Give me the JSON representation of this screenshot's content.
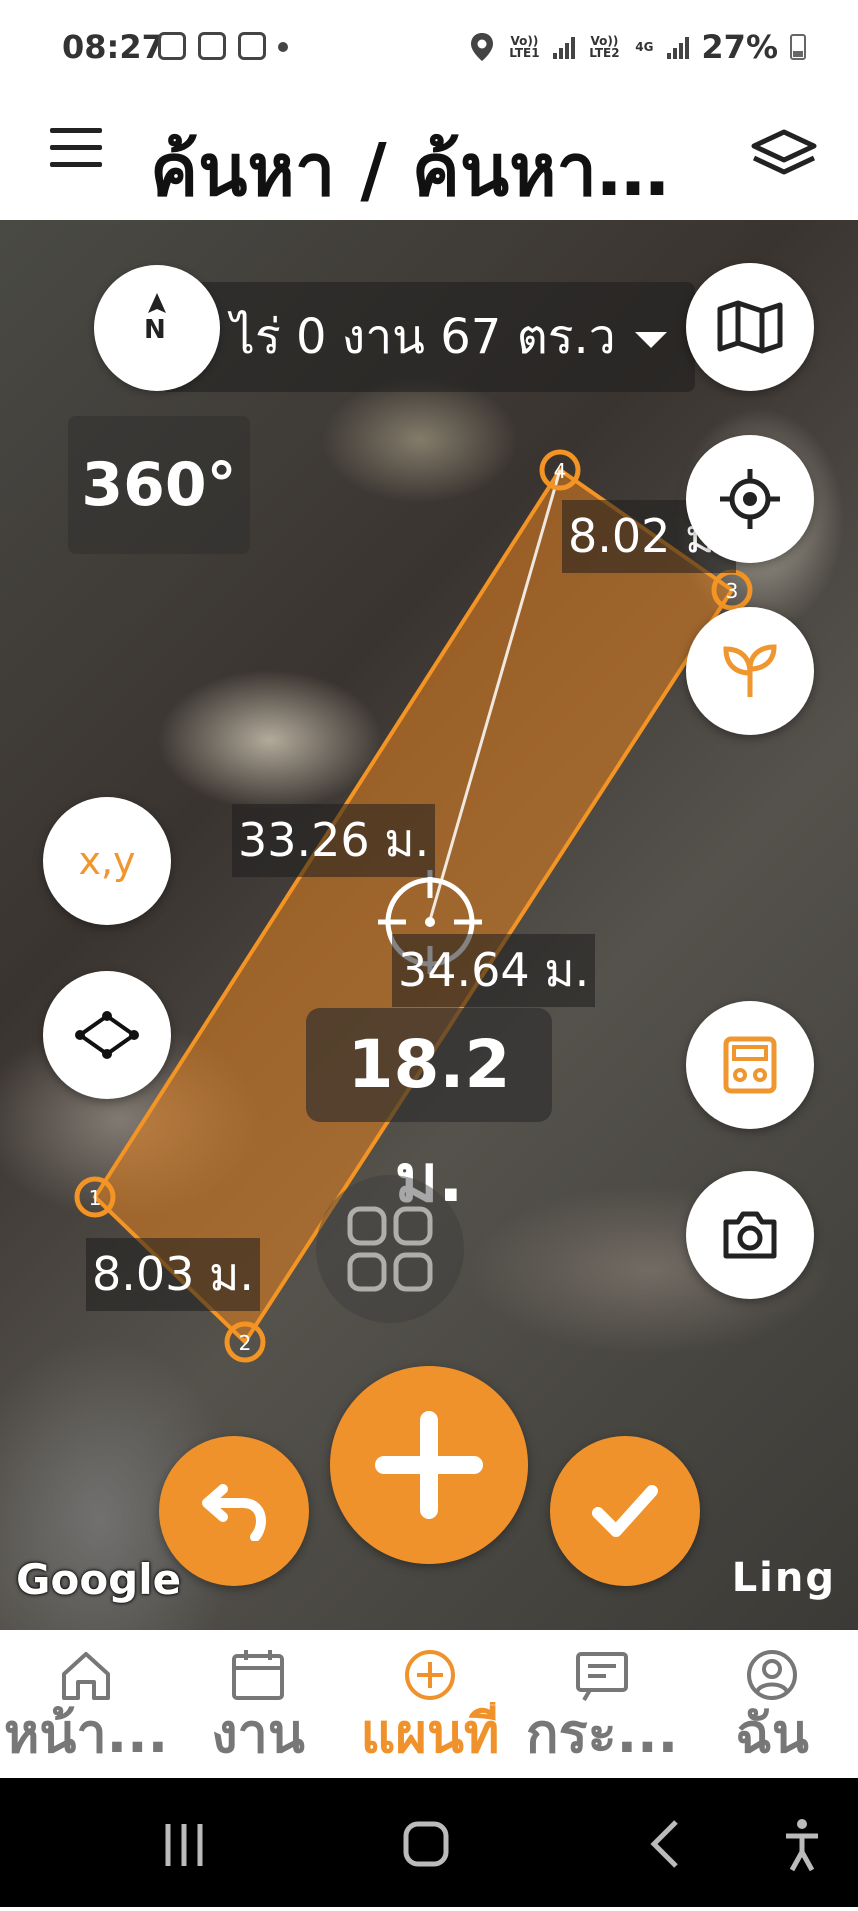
{
  "status_bar": {
    "time": "08:27",
    "battery": "27%",
    "net1": "Vo)) LTE1",
    "net2": "Vo)) LTE2",
    "net2_type": "4G"
  },
  "app_bar": {
    "title": "ค้นหา / ค้นหาพิ..."
  },
  "map": {
    "area_text": "0 ไร่ 0 งาน 67 ตร.ว",
    "compass_label": "N",
    "view_mode": "360°",
    "segments": [
      "8.02 ม.",
      "33.26 ม.",
      "34.64 ม.",
      "8.03 ม."
    ],
    "center_distance": "18.2 ม.",
    "coord_button": "x,y",
    "vertices": [
      "1",
      "2",
      "3",
      "4"
    ],
    "attribution": "Google",
    "watermark": "Ling",
    "accent_color": "#f0922b"
  },
  "bottom_nav": {
    "items": [
      {
        "label": "หน้า...",
        "icon": "home-icon"
      },
      {
        "label": "งาน",
        "icon": "calendar-icon"
      },
      {
        "label": "แผนที่",
        "icon": "plus-circle-icon",
        "active": true
      },
      {
        "label": "กระ...",
        "icon": "board-icon"
      },
      {
        "label": "ฉัน",
        "icon": "user-icon"
      }
    ]
  }
}
